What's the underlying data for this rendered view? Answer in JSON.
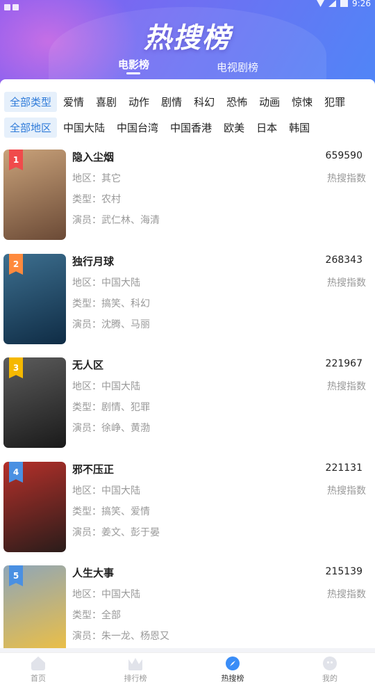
{
  "status_bar": {
    "time": "9:26"
  },
  "header": {
    "title": "热搜榜"
  },
  "top_tabs": [
    {
      "label": "电影榜",
      "active": true
    },
    {
      "label": "电视剧榜",
      "active": false
    }
  ],
  "filters": {
    "types": [
      "全部类型",
      "爱情",
      "喜剧",
      "动作",
      "剧情",
      "科幻",
      "恐怖",
      "动画",
      "惊悚",
      "犯罪"
    ],
    "selected_type": "全部类型",
    "regions": [
      "全部地区",
      "中国大陆",
      "中国台湾",
      "中国香港",
      "欧美",
      "日本",
      "韩国"
    ],
    "selected_region": "全部地区"
  },
  "labels": {
    "region": "地区：",
    "genre": "类型：",
    "cast": "演员：",
    "index": "热搜指数"
  },
  "movies": [
    {
      "rank": "1",
      "title": "隐入尘烟",
      "score": "659590",
      "region": "其它",
      "genre": "农村",
      "cast": "武仁林、海清",
      "rank_color": "#f04b4b",
      "poster_colors": [
        "#c9a27a",
        "#6b4a36"
      ]
    },
    {
      "rank": "2",
      "title": "独行月球",
      "score": "268343",
      "region": "中国大陆",
      "genre": "搞笑、科幻",
      "cast": "沈腾、马丽",
      "rank_color": "#ff8a3d",
      "poster_colors": [
        "#3d6f8f",
        "#0f2c45"
      ]
    },
    {
      "rank": "3",
      "title": "无人区",
      "score": "221967",
      "region": "中国大陆",
      "genre": "剧情、犯罪",
      "cast": "徐峥、黄渤",
      "rank_color": "#f5b800",
      "poster_colors": [
        "#5c5c5c",
        "#1a1a1a"
      ]
    },
    {
      "rank": "4",
      "title": "邪不压正",
      "score": "221131",
      "region": "中国大陆",
      "genre": "搞笑、爱情",
      "cast": "姜文、彭于晏",
      "rank_color": "#4a90e2",
      "poster_colors": [
        "#b5302a",
        "#2a1c1a"
      ]
    },
    {
      "rank": "5",
      "title": "人生大事",
      "score": "215139",
      "region": "中国大陆",
      "genre": "全部",
      "cast": "朱一龙、杨恩又",
      "rank_color": "#4a90e2",
      "poster_colors": [
        "#8fa6b8",
        "#f0c040"
      ]
    }
  ],
  "bottom_nav": [
    {
      "label": "首页",
      "icon": "home-icon",
      "active": false
    },
    {
      "label": "排行榜",
      "icon": "crown-icon",
      "active": false
    },
    {
      "label": "热搜榜",
      "icon": "compass-icon",
      "active": true
    },
    {
      "label": "我的",
      "icon": "face-icon",
      "active": false
    }
  ]
}
